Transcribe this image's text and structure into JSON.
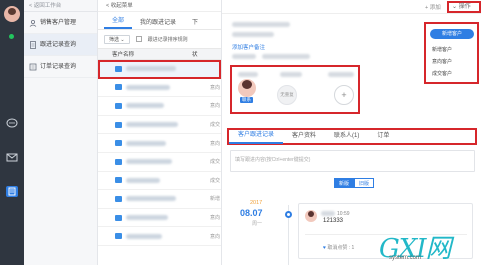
{
  "sidebar": {
    "back": "< 返回工作台",
    "items": [
      {
        "label": "销售客户管理"
      },
      {
        "label": "跟进记录查询"
      },
      {
        "label": "订单记录查询"
      }
    ]
  },
  "middle": {
    "topbar": "< 收起菜单",
    "tabs": [
      "全部",
      "我的跟进记录",
      "下"
    ],
    "filter": {
      "select": "筛选 ⌄",
      "checkbox_label": "跟进记录排序规则"
    },
    "columns": [
      "客户名称",
      "状"
    ],
    "rows": [
      {
        "status": ""
      },
      {
        "status": "意向"
      },
      {
        "status": "意向"
      },
      {
        "status": "成交"
      },
      {
        "status": "意向"
      },
      {
        "status": "成交"
      },
      {
        "status": "成交"
      },
      {
        "status": "新增"
      },
      {
        "status": "意向"
      },
      {
        "status": "意向"
      }
    ]
  },
  "detail": {
    "add": "+ 添加",
    "operate": "操作",
    "note_link": "添加客户备注",
    "contact_tag": "联系",
    "contact_none": "无重复",
    "contact_add": "+",
    "tabs": [
      "客户跟进记录",
      "客户资料",
      "联系人(1)",
      "订单"
    ],
    "note_placeholder": "填写跟进内容(按Ctrl+enter键提交)",
    "segment": [
      "新版",
      "旧版"
    ],
    "year": "2017",
    "date": "08.07",
    "date_suffix": "周一",
    "record": {
      "time": "10:59",
      "content": "121333",
      "likes": "取消点赞 : 1"
    }
  },
  "dropdown": {
    "primary": "新增客户",
    "items": [
      "新增客户",
      "意向客户",
      "成交客户"
    ]
  },
  "watermark": {
    "big": "GXI网",
    "small": "system.com"
  },
  "colors": {
    "accent": "#2f7ee3",
    "highlight": "#d6262b",
    "rail": "#2f3640"
  }
}
